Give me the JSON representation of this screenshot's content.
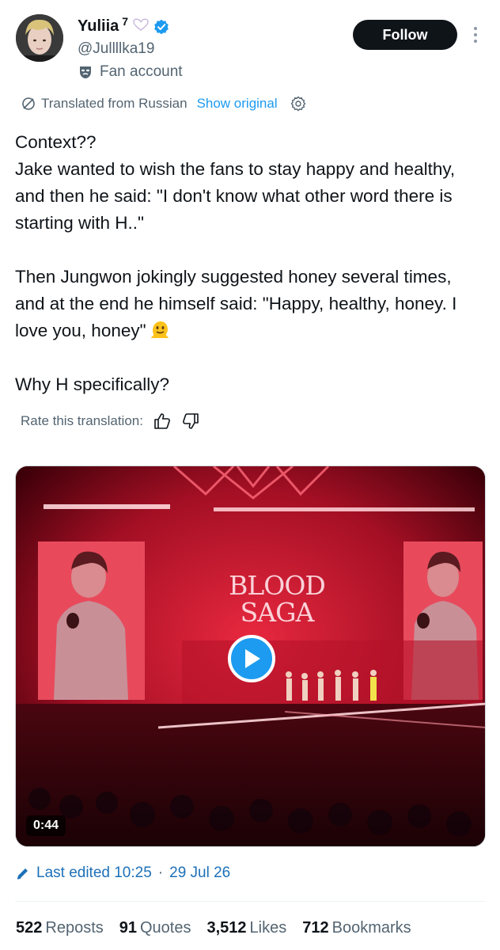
{
  "author": {
    "display_name": "Yuliia",
    "name_suffix": "7",
    "handle": "@Jullllka19",
    "account_label": "Fan account",
    "follow_label": "Follow"
  },
  "translation": {
    "notice": "Translated from Russian",
    "show_original": "Show original",
    "rate_label": "Rate this translation:"
  },
  "tweet": {
    "paragraphs": [
      "Context??\nJake wanted to wish the fans to stay happy and healthy, and then he said: \"I don't know what other word there is starting with H..\"",
      "Then Jungwon jokingly suggested honey several times, and at the end he himself said: \"Happy, healthy, honey. I love you, honey\"",
      "Why H specifically?"
    ],
    "emoji_name": "melting-face-emoji"
  },
  "media": {
    "duration": "0:44",
    "stage_title_line1": "BLOOD",
    "stage_title_line2": "SAGA"
  },
  "meta": {
    "edited_label": "Last edited 10:25",
    "separator": "·",
    "date": "29 Jul 26"
  },
  "stats": {
    "reposts_count": "522",
    "reposts_label": "Reposts",
    "quotes_count": "91",
    "quotes_label": "Quotes",
    "likes_count": "3,512",
    "likes_label": "Likes",
    "bookmarks_count": "712",
    "bookmarks_label": "Bookmarks"
  },
  "colors": {
    "accent": "#1d9bf0",
    "text_primary": "#0f1419",
    "text_secondary": "#536471",
    "stage_red": "#c8102e"
  }
}
